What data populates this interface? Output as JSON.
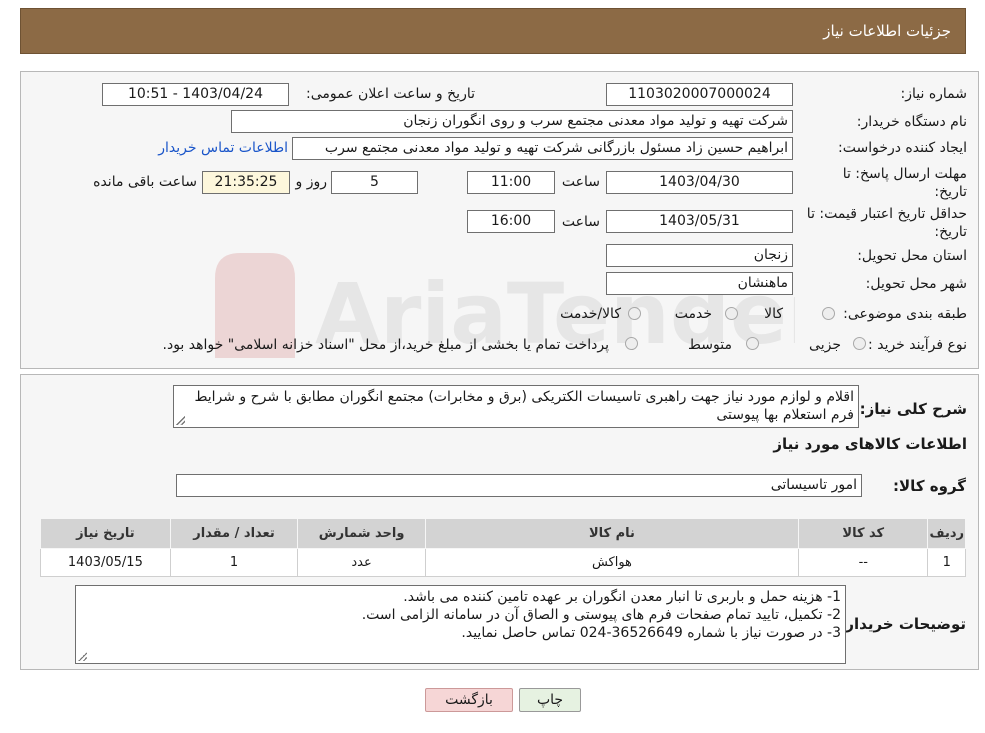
{
  "header": {
    "title": "جزئیات اطلاعات نیاز"
  },
  "details": {
    "need_number": {
      "label": "شماره نیاز:",
      "value": "1103020007000024"
    },
    "announce_datetime": {
      "label": "تاریخ و ساعت اعلان عمومی:",
      "value": "1403/04/24 - 10:51"
    },
    "buyer_org": {
      "label": "نام دستگاه خریدار:",
      "value": "شرکت تهیه و تولید مواد معدنی مجتمع سرب و روی انگوران   زنجان"
    },
    "requester": {
      "label": "ایجاد کننده درخواست:",
      "value": "ابراهیم حسین زاد مسئول بازرگانی شرکت تهیه و تولید مواد معدنی مجتمع سرب",
      "link": "اطلاعات تماس خریدار"
    },
    "deadline": {
      "label": "مهلت ارسال پاسخ: تا تاریخ:",
      "date": "1403/04/30",
      "time_label": "ساعت",
      "time": "11:00",
      "days": "5",
      "days_label": "روز و",
      "remaining": "21:35:25",
      "remaining_label": "ساعت باقی مانده"
    },
    "validity": {
      "label": "حداقل تاریخ اعتبار قیمت: تا تاریخ:",
      "date": "1403/05/31",
      "time_label": "ساعت",
      "time": "16:00"
    },
    "province": {
      "label": "استان محل تحویل:",
      "value": "زنجان"
    },
    "city": {
      "label": "شهر محل تحویل:",
      "value": "ماهنشان"
    },
    "category": {
      "label": "طبقه بندی موضوعی:",
      "options": [
        "کالا",
        "خدمت",
        "کالا/خدمت"
      ]
    },
    "process": {
      "label": "نوع فرآیند خرید :",
      "options": [
        "جزیی",
        "متوسط"
      ],
      "note": "پرداخت تمام یا بخشی از مبلغ خرید،از محل \"اسناد خزانه اسلامی\" خواهد بود."
    }
  },
  "description": {
    "label": "شرح کلی نیاز:",
    "text": "اقلام و لوازم مورد نیاز جهت راهبری تاسیسات الکتریکی (برق و مخابرات) مجتمع انگوران مطابق با شرح و شرایط فرم استعلام بها پیوستی"
  },
  "goods": {
    "section_title": "اطلاعات کالاهای مورد نیاز",
    "group_label": "گروه کالا:",
    "group_value": "امور تاسیساتی",
    "columns": [
      "ردیف",
      "کد کالا",
      "نام کالا",
      "واحد شمارش",
      "تعداد / مقدار",
      "تاریخ نیاز"
    ],
    "rows": [
      [
        "1",
        "--",
        "هواکش",
        "عدد",
        "1",
        "1403/05/15"
      ]
    ]
  },
  "buyer_notes": {
    "label": "توضیحات خریدار:",
    "lines": [
      "1- هزینه حمل و باربری تا انبار معدن انگوران بر عهده تامین کننده می باشد.",
      "2- تکمیل، تایید تمام صفحات فرم های پیوستی و الصاق آن در سامانه الزامی است.",
      "3- در صورت نیاز با شماره 36526649-024 تماس حاصل نمایید."
    ]
  },
  "buttons": {
    "print": "چاپ",
    "back": "بازگشت"
  },
  "watermark": {
    "text": "AriaTender.neT"
  },
  "colors": {
    "header": "#8c6a45",
    "link": "#1a55c9",
    "back_button": "#f6d6d6",
    "print_button": "#e6f2e1"
  }
}
